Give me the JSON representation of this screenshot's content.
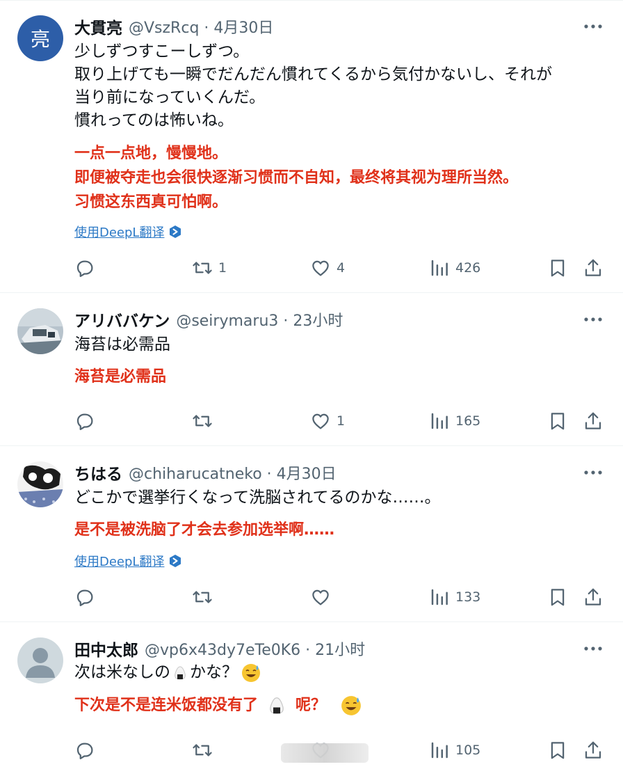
{
  "posts": [
    {
      "name": "大貫亮",
      "meta": "@VszRcq · 4月30日",
      "avatar_letter": "亮",
      "lines": [
        "少しずつすこーしずつ。",
        "取り上げても一瞬でだんだん慣れてくるから気付かないし、それが",
        "当り前になっていくんだ。",
        "慣れってのは怖いね。"
      ],
      "translation": [
        "一点一点地，慢慢地。",
        "即便被夺走也会很快逐渐习惯而不自知，最终将其视为理所当然。",
        "习惯这东西真可怕啊。"
      ],
      "translate_link": "使用DeepL翻译",
      "counts": {
        "reply": "",
        "retweet": "1",
        "like": "4",
        "views": "426"
      }
    },
    {
      "name": "アリババケン",
      "meta": "@seirymaru3 · 23小时",
      "lines": [
        "海苔は必需品"
      ],
      "translation": [
        "海苔是必需品"
      ],
      "counts": {
        "reply": "",
        "retweet": "",
        "like": "1",
        "views": "165"
      }
    },
    {
      "name": "ちはる",
      "meta": "@chiharucatneko · 4月30日",
      "lines": [
        "どこかで選挙行くなって洗脳されてるのかな……。"
      ],
      "translation": [
        "是不是被洗脑了才会去参加选举啊……"
      ],
      "translate_link": "使用DeepL翻译",
      "counts": {
        "reply": "",
        "retweet": "",
        "like": "",
        "views": "133"
      }
    },
    {
      "name": "田中太郎",
      "meta": "@vp6x43dy7eTe0K6 · 21小时",
      "line_before": "次は米なしの",
      "line_after": "かな？",
      "translation_before": "下次是不是连米饭都没有了",
      "translation_after": "呢？",
      "counts": {
        "reply": "",
        "retweet": "",
        "like": "",
        "views": "105"
      }
    }
  ],
  "icons": {
    "reply": "reply-icon",
    "retweet": "retweet-icon",
    "like": "like-icon",
    "views": "views-icon",
    "bookmark": "bookmark-icon",
    "share": "share-icon",
    "more": "more-icon"
  },
  "colors": {
    "translation": "#e0311a",
    "link": "#2c79c6",
    "secondary": "#536471"
  }
}
